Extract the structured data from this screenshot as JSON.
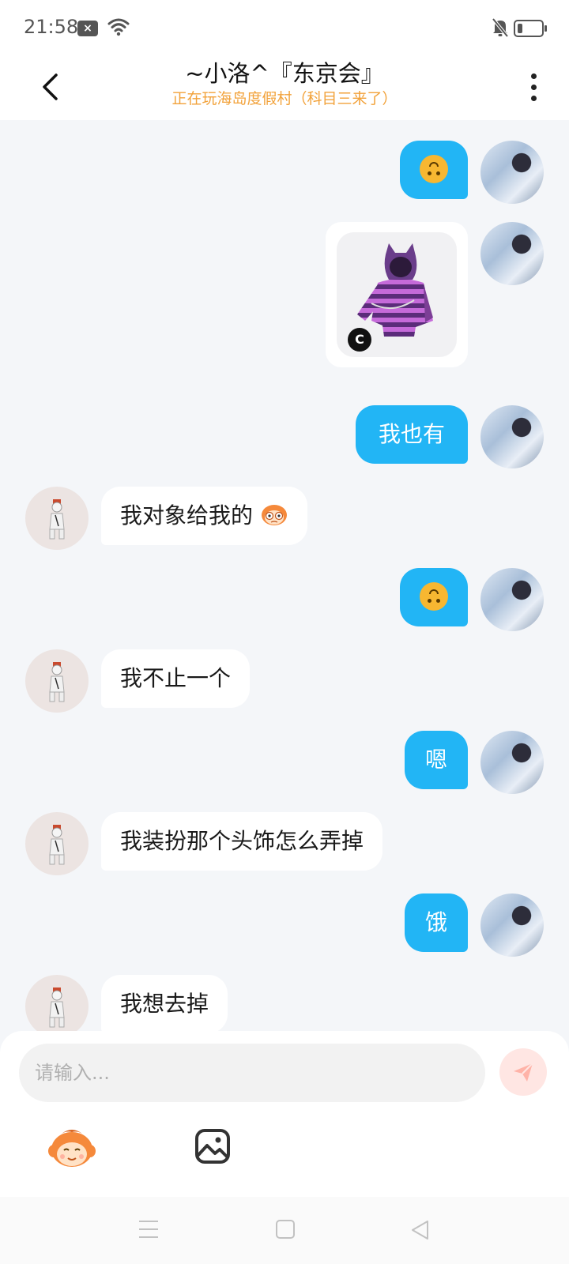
{
  "status_bar": {
    "time": "21:58",
    "icons": [
      "notification-x-icon",
      "wifi-icon",
      "bell-muted-icon",
      "battery-icon"
    ]
  },
  "header": {
    "title": "~小洛^『东京会』",
    "subtitle": "正在玩海岛度假村（科目三来了）",
    "subtitle_color": "#f2a23a"
  },
  "messages": [
    {
      "from": "me",
      "type": "emoji",
      "emoji": "upside-down-face"
    },
    {
      "from": "me",
      "type": "sticker",
      "badge": "C",
      "content": "purple-hoodie-item"
    },
    {
      "from": "me",
      "type": "text",
      "text": "我也有"
    },
    {
      "from": "them",
      "type": "text",
      "text": "我对象给我的",
      "trailing_emoji": "monkey-emoji"
    },
    {
      "from": "me",
      "type": "emoji",
      "emoji": "upside-down-face"
    },
    {
      "from": "them",
      "type": "text",
      "text": "我不止一个"
    },
    {
      "from": "me",
      "type": "text",
      "text": "嗯"
    },
    {
      "from": "them",
      "type": "text",
      "text": "我装扮那个头饰怎么弄掉"
    },
    {
      "from": "me",
      "type": "text",
      "text": "饿"
    },
    {
      "from": "them",
      "type": "text",
      "text": "我想去掉"
    }
  ],
  "input": {
    "placeholder": "请输入...",
    "value": ""
  },
  "toolbar": {
    "emoji_icon": "monkey-face-icon",
    "image_icon": "image-icon",
    "send_icon": "send-icon"
  },
  "colors": {
    "my_bubble": "#22b5f5",
    "their_bubble": "#ffffff",
    "chat_background": "#f4f6f9",
    "send_button_bg": "#ffe6e3"
  }
}
